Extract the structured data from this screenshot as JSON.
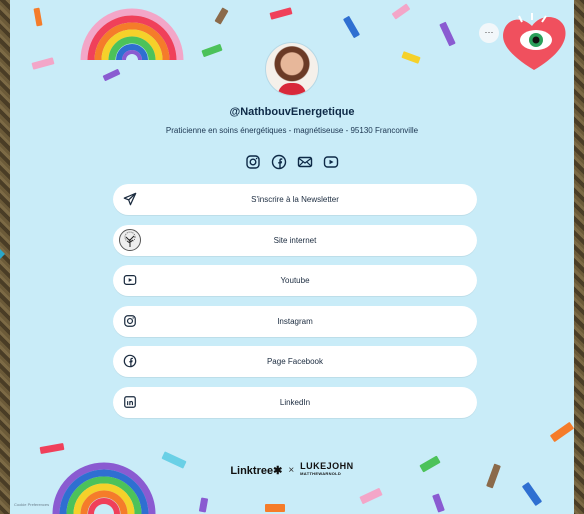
{
  "profile": {
    "handle": "@NathbouvEnergetique",
    "bio": "Praticienne en soins énergétiques - magnétiseuse - 95130 Franconville"
  },
  "socials": [
    {
      "icon": "instagram-icon"
    },
    {
      "icon": "facebook-icon"
    },
    {
      "icon": "email-icon"
    },
    {
      "icon": "youtube-icon"
    }
  ],
  "links": [
    {
      "label": "S'inscrire à la Newsletter",
      "icon": "send-icon"
    },
    {
      "label": "Site internet",
      "icon": "tree-logo-icon"
    },
    {
      "label": "Youtube",
      "icon": "youtube-icon"
    },
    {
      "label": "Instagram",
      "icon": "instagram-icon"
    },
    {
      "label": "Page Facebook",
      "icon": "facebook-icon"
    },
    {
      "label": "LinkedIn",
      "icon": "linkedin-icon"
    }
  ],
  "menu": {
    "more_label": "···"
  },
  "footer": {
    "linktree": "Linktree✱",
    "separator": "×",
    "partner_main": "LUKEJOHN",
    "partner_sub": "MATTHEWARNOLD",
    "cookie": "Cookie Preferences"
  },
  "colors": {
    "background": "#c9ecf8",
    "button": "#ffffff",
    "text": "#1b2b3f"
  }
}
